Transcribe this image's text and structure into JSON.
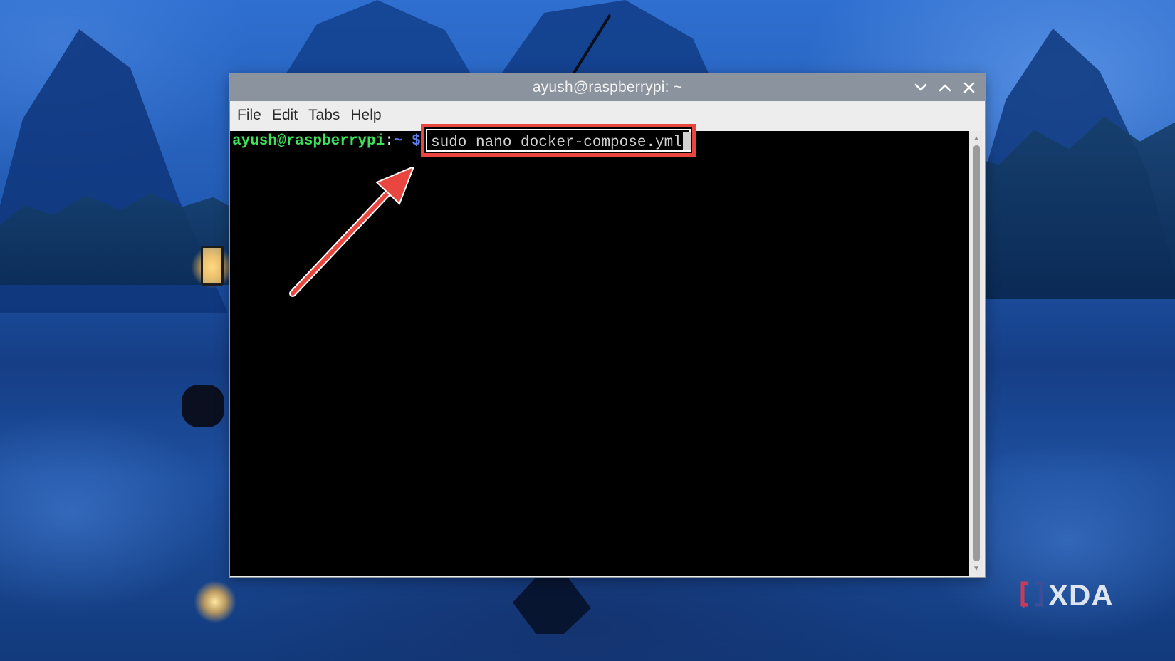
{
  "window": {
    "title": "ayush@raspberrypi: ~",
    "controls": {
      "minimize_icon": "chevron-down-icon",
      "maximize_icon": "chevron-up-icon",
      "close_icon": "close-icon"
    }
  },
  "menu": {
    "items": [
      "File",
      "Edit",
      "Tabs",
      "Help"
    ]
  },
  "terminal": {
    "prompt_user": "ayush@raspberrypi",
    "prompt_colon": ":",
    "prompt_path": "~",
    "prompt_symbol": "$",
    "command": "sudo nano docker-compose.yml"
  },
  "annotation": {
    "highlight_color": "#e8463f",
    "arrow_color": "#e8463f"
  },
  "watermark": {
    "text": "XDA"
  },
  "colors": {
    "titlebar": "#8b949e",
    "terminal_bg": "#000000",
    "prompt_user": "#3fe05a",
    "prompt_path": "#5c7ee8"
  }
}
